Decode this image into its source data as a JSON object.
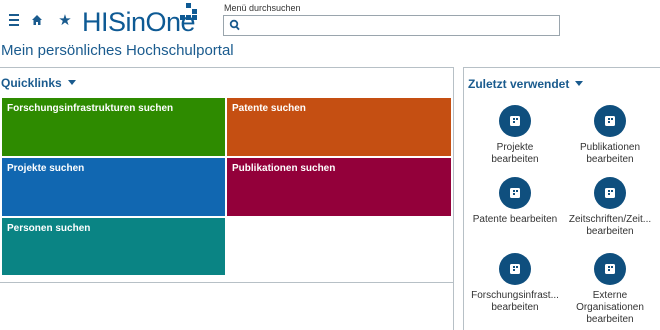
{
  "header": {
    "logo_text": "HISinOne",
    "search_label": "Menü durchsuchen",
    "search_value": ""
  },
  "page_title": "Mein persönliches Hochschulportal",
  "quicklinks": {
    "heading": "Quicklinks",
    "tiles": [
      {
        "label": "Forschungsinfrastrukturen suchen",
        "color": "#2e8b00"
      },
      {
        "label": "Patente suchen",
        "color": "#c54f12"
      },
      {
        "label": "Projekte suchen",
        "color": "#1167b1"
      },
      {
        "label": "Publikationen suchen",
        "color": "#93003a"
      },
      {
        "label": "Personen suchen",
        "color": "#0a8484"
      }
    ]
  },
  "recent": {
    "heading": "Zuletzt verwendet",
    "items": [
      {
        "line1": "Projekte",
        "line2": "bearbeiten"
      },
      {
        "line1": "Publikationen",
        "line2": "bearbeiten"
      },
      {
        "line1": "Patente bearbeiten",
        "line2": ""
      },
      {
        "line1": "Zeitschriften/Zeit...",
        "line2": "bearbeiten"
      },
      {
        "line1": "Forschungsinfrast...",
        "line2": "bearbeiten"
      },
      {
        "line1": "Externe",
        "line2": "Organisationen",
        "line3": "bearbeiten"
      }
    ]
  },
  "colors": {
    "brand": "#0e5a94",
    "heading": "#1a5b8e",
    "icon_circle": "#0f4f7e"
  }
}
